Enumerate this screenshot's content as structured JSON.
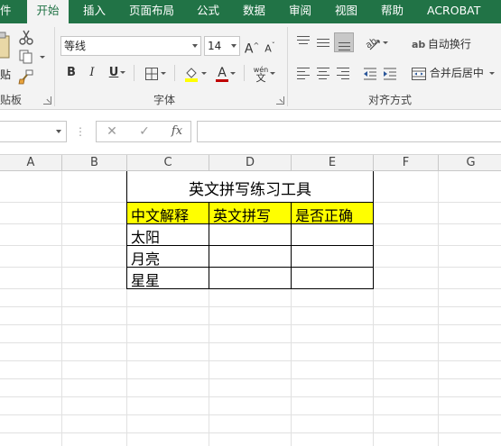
{
  "tabs": [
    {
      "label": "件",
      "active": false
    },
    {
      "label": "开始",
      "active": true
    },
    {
      "label": "插入",
      "active": false
    },
    {
      "label": "页面布局",
      "active": false
    },
    {
      "label": "公式",
      "active": false
    },
    {
      "label": "数据",
      "active": false
    },
    {
      "label": "审阅",
      "active": false
    },
    {
      "label": "视图",
      "active": false
    },
    {
      "label": "帮助",
      "active": false
    },
    {
      "label": "ACROBAT",
      "active": false
    }
  ],
  "clipboard": {
    "paste_partial": "贴",
    "group_label_partial": "贴板"
  },
  "font": {
    "name": "等线",
    "size": "14",
    "grow_label": "A",
    "shrink_label": "A",
    "bold_label": "B",
    "italic_label": "I",
    "underline_label": "U",
    "font_color_label": "A",
    "phonetic_top": "wén",
    "phonetic_bottom": "文",
    "group_label": "字体",
    "fill_color": "#ffff00",
    "font_color": "#c00000"
  },
  "alignment": {
    "wrap_text_label": "自动换行",
    "merge_center_label": "合并后居中",
    "group_label": "对齐方式"
  },
  "formula_bar": {
    "cancel_icon": "✕",
    "enter_icon": "✓",
    "fx_label": "fx",
    "name_value": "",
    "formula_value": ""
  },
  "columns": [
    "A",
    "B",
    "C",
    "D",
    "E",
    "F",
    "G"
  ],
  "sheet": {
    "title": "英文拼写练习工具",
    "headers": [
      "中文解释",
      "英文拼写",
      "是否正确"
    ],
    "rows": [
      [
        "太阳",
        "",
        ""
      ],
      [
        "月亮",
        "",
        ""
      ],
      [
        "星星",
        "",
        ""
      ]
    ],
    "header_fill": "#ffff00"
  }
}
